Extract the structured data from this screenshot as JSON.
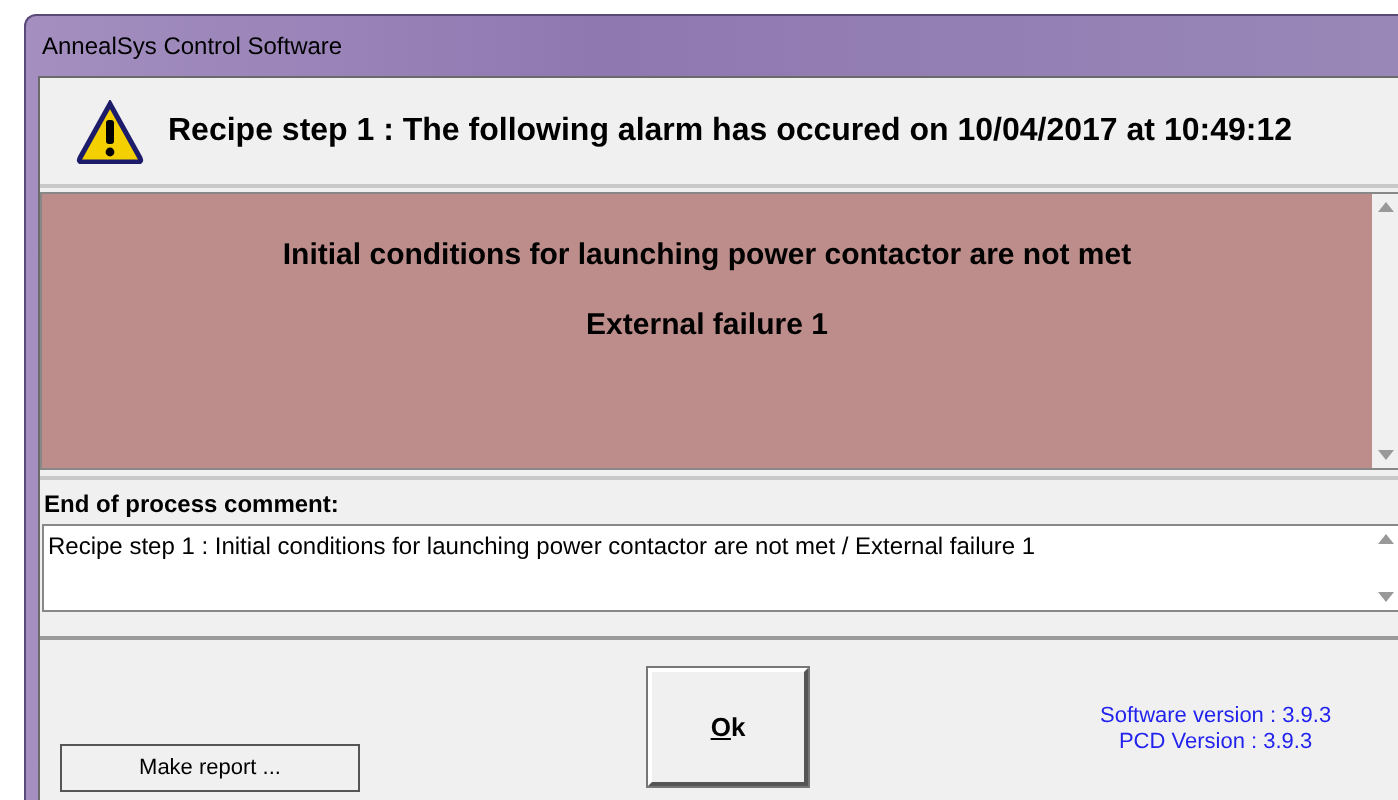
{
  "window": {
    "title": "AnnealSys Control Software"
  },
  "header": {
    "message": "Recipe step 1 : The following alarm has occured on 10/04/2017 at 10:49:12"
  },
  "alarm": {
    "lines": [
      "Initial conditions for launching power contactor are not met",
      "External failure 1"
    ]
  },
  "comment": {
    "label": "End of process comment:",
    "value": "Recipe step 1 : Initial conditions for launching power contactor are not met / External failure 1"
  },
  "buttons": {
    "report": "Make report ...",
    "ok": "Ok"
  },
  "versions": [
    "Software version : 3.9.3",
    "PCD Version : 3.9.3"
  ]
}
